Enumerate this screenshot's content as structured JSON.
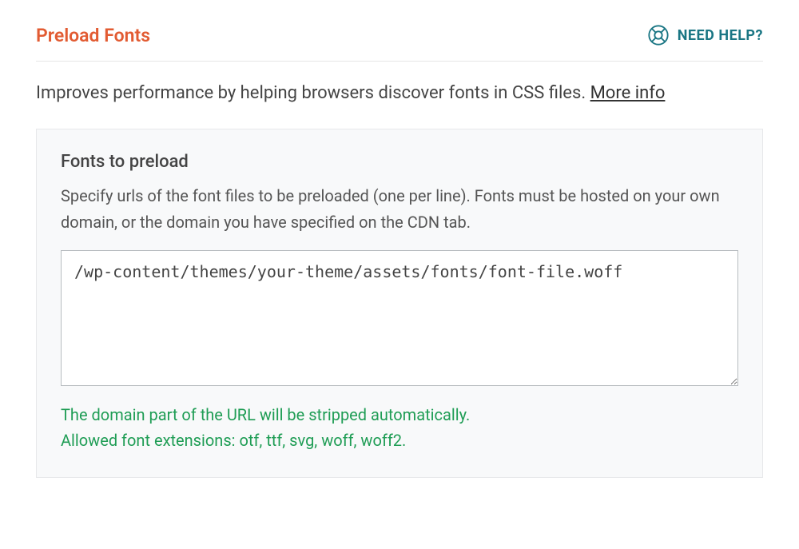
{
  "header": {
    "title": "Preload Fonts",
    "help_label": "NEED HELP?"
  },
  "description": {
    "text": "Improves performance by helping browsers discover fonts in CSS files. ",
    "more_info_label": "More info"
  },
  "card": {
    "title": "Fonts to preload",
    "description": "Specify urls of the font files to be preloaded (one per line). Fonts must be hosted on your own domain, or the domain you have specified on the CDN tab.",
    "textarea_value": "/wp-content/themes/your-theme/assets/fonts/font-file.woff",
    "hint_line1": "The domain part of the URL will be stripped automatically.",
    "hint_line2": "Allowed font extensions: otf, ttf, svg, woff, woff2."
  }
}
